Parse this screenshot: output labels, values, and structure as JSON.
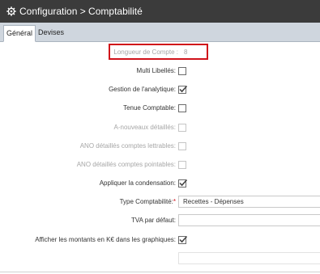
{
  "titlebar": {
    "title": "Configuration > Comptabilité",
    "icon": "gear-icon"
  },
  "tabs": [
    {
      "label": "Général",
      "active": true
    },
    {
      "label": "Devises",
      "active": false
    }
  ],
  "form": {
    "longueur_label": "Longueur de Compte :",
    "longueur_value": "8",
    "multi_libelles_label": "Multi Libellés:",
    "multi_libelles_checked": false,
    "gestion_analytique_label": "Gestion de l'analytique:",
    "gestion_analytique_checked": true,
    "tenue_comptable_label": "Tenue Comptable:",
    "tenue_comptable_checked": false,
    "a_nouveaux_label": "A-nouveaux détaillés:",
    "ano_lettrables_label": "ANO détaillés comptes lettrables:",
    "ano_pointables_label": "ANO détaillés comptes pointables:",
    "condensation_label": "Appliquer la condensation:",
    "condensation_checked": true,
    "type_comptabilite_label": "Type Comptabilité:",
    "type_comptabilite_required": "*",
    "type_comptabilite_value": "Recettes - Dépenses",
    "tva_label": "TVA par défaut:",
    "tva_value": "",
    "montants_label": "Afficher les montants en K€ dans les graphiques:",
    "montants_checked": true
  },
  "colors": {
    "titlebar": "#3b3b3b",
    "tabbar": "#cfd6de",
    "highlight": "#d0121a",
    "check": "#444444"
  }
}
